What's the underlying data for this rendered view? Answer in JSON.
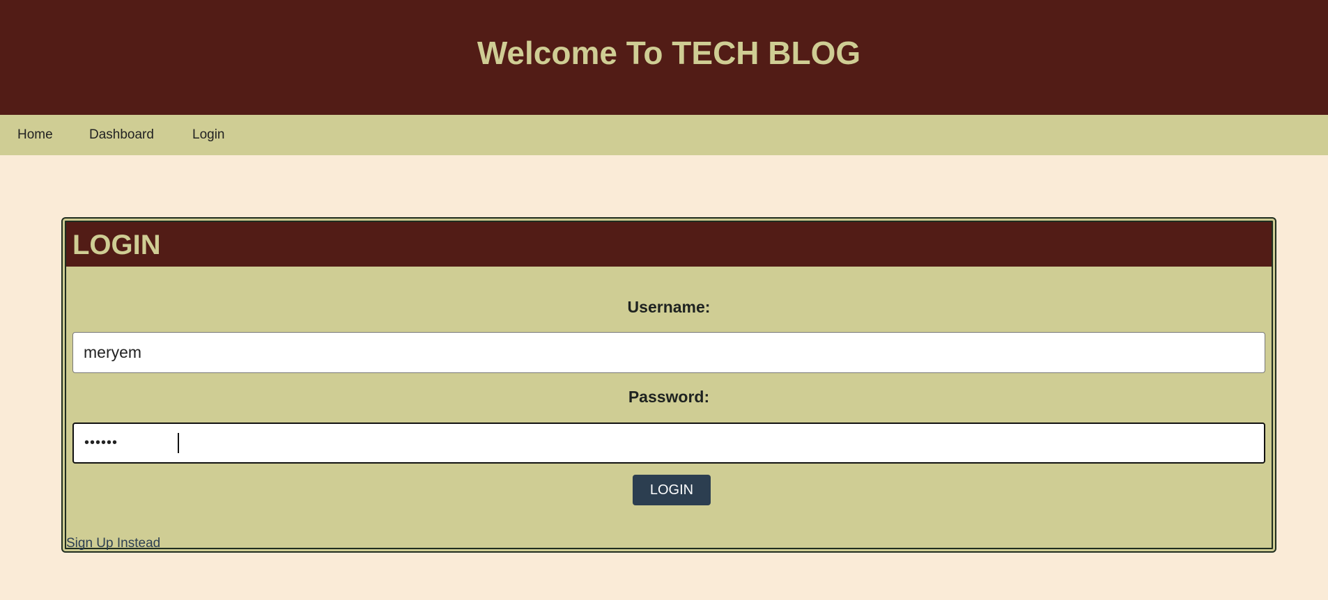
{
  "header": {
    "title": "Welcome To TECH BLOG"
  },
  "nav": {
    "items": [
      {
        "label": "Home"
      },
      {
        "label": "Dashboard"
      },
      {
        "label": "Login"
      }
    ]
  },
  "login_form": {
    "title": "LOGIN",
    "username_label": "Username:",
    "username_value": "meryem",
    "password_label": "Password:",
    "password_value": "••••••",
    "submit_label": "LOGIN",
    "signup_link": "Sign Up Instead"
  },
  "colors": {
    "header_bg": "#521c16",
    "accent_gold": "#cfcd94",
    "page_bg": "#faebd7",
    "button_bg": "#2c3e50"
  }
}
